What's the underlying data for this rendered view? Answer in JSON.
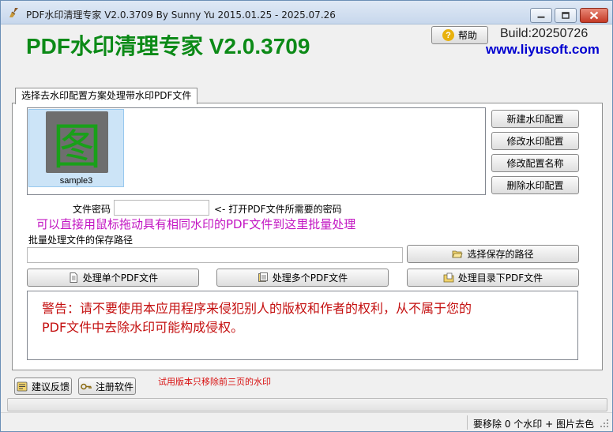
{
  "window": {
    "title": "PDF水印清理专家 V2.0.3709 By Sunny Yu 2015.01.25 - 2025.07.26",
    "controls": {
      "minimize": "minimize",
      "maximize": "maximize",
      "close": "close"
    }
  },
  "header": {
    "app_title": "PDF水印清理专家 V2.0.3709",
    "help_label": "帮助",
    "help_icon": "?",
    "build": "Build:20250726",
    "website": "www.liyusoft.com"
  },
  "tab": {
    "label": "选择去水印配置方案处理带水印PDF文件"
  },
  "profiles": [
    {
      "icon_char": "图",
      "label": "sample3",
      "selected": true
    }
  ],
  "profile_buttons": {
    "new": "新建水印配置",
    "edit": "修改水印配置",
    "rename": "修改配置名称",
    "delete": "删除水印配置"
  },
  "password": {
    "label": "文件密码",
    "value": "",
    "hint": "<- 打开PDF文件所需要的密码"
  },
  "drag_hint": "可以直接用鼠标拖动具有相同水印的PDF文件到这里批量处理",
  "save_path": {
    "label": "批量处理文件的保存路径",
    "value": "",
    "choose_button": "选择保存的路径"
  },
  "actions": {
    "single": "处理单个PDF文件",
    "multiple": "处理多个PDF文件",
    "folder": "处理目录下PDF文件"
  },
  "warning": {
    "line1": "警告：请不要使用本应用程序来侵犯别人的版权和作者的权利，从不属于您的",
    "line2": "PDF文件中去除水印可能构成侵权。"
  },
  "footer": {
    "feedback": "建议反馈",
    "register": "注册软件",
    "trial_note": "试用版本只移除前三页的水印",
    "progress": 0,
    "status": "要移除 0 个水印 + 图片去色"
  },
  "colors": {
    "brand_green": "#0c8a17",
    "link_blue": "#0000d0",
    "hint_magenta": "#c214c2",
    "warning_red": "#c41010"
  }
}
